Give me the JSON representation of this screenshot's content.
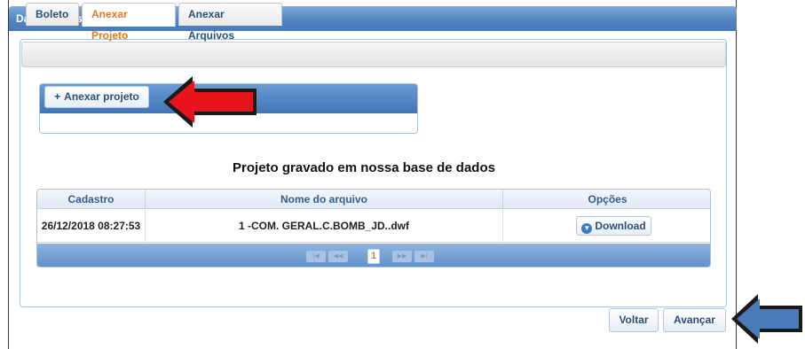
{
  "panel": {
    "title": "Dados Finais"
  },
  "tabs": [
    {
      "label": "Boleto"
    },
    {
      "label": "Anexar Projeto",
      "active": true
    },
    {
      "label": "Anexar Arquivos"
    }
  ],
  "upload": {
    "button_label": "Anexar projeto",
    "icon": "plus-icon"
  },
  "section_title": "Projeto gravado em nossa base de dados",
  "table": {
    "columns": [
      "Cadastro",
      "Nome do arquivo",
      "Opções"
    ],
    "rows": [
      {
        "cadastro": "26/12/2018 08:27:53",
        "arquivo": "1 -COM. GERAL.C.BOMB_JD..dwf",
        "option_label": "Download",
        "option_icon": "download-icon"
      }
    ],
    "pager": {
      "current_page": "1"
    }
  },
  "footer": {
    "back_label": "Voltar",
    "next_label": "Avançar"
  },
  "colors": {
    "header_blue": "#4f82c0",
    "active_tab": "#e07b1f",
    "red_arrow": "#e8141b",
    "blue_arrow": "#4a7ab8"
  }
}
